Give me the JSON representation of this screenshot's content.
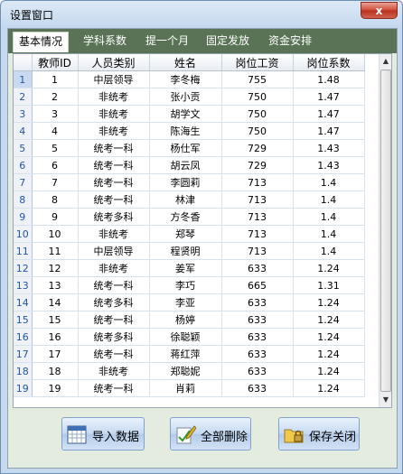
{
  "window": {
    "title": "设置窗口",
    "close_glyph": "x"
  },
  "tabs": [
    {
      "label": "基本情况",
      "active": true
    },
    {
      "label": "学科系数",
      "active": false
    },
    {
      "label": "提一个月",
      "active": false
    },
    {
      "label": "固定发放",
      "active": false
    },
    {
      "label": "资金安排",
      "active": false
    }
  ],
  "table": {
    "columns": [
      "教师ID",
      "人员类别",
      "姓名",
      "岗位工资",
      "岗位系数"
    ],
    "rows": [
      {
        "rn": "1",
        "id": "1",
        "category": "中层领导",
        "name": "李冬梅",
        "salary": "755",
        "coef": "1.48"
      },
      {
        "rn": "2",
        "id": "2",
        "category": "非统考",
        "name": "张小贡",
        "salary": "750",
        "coef": "1.47"
      },
      {
        "rn": "3",
        "id": "3",
        "category": "非统考",
        "name": "胡学文",
        "salary": "750",
        "coef": "1.47"
      },
      {
        "rn": "4",
        "id": "4",
        "category": "非统考",
        "name": "陈海生",
        "salary": "750",
        "coef": "1.47"
      },
      {
        "rn": "5",
        "id": "5",
        "category": "统考一科",
        "name": "杨仕军",
        "salary": "729",
        "coef": "1.43"
      },
      {
        "rn": "6",
        "id": "6",
        "category": "统考一科",
        "name": "胡云凤",
        "salary": "729",
        "coef": "1.43"
      },
      {
        "rn": "7",
        "id": "7",
        "category": "统考一科",
        "name": "李圆莉",
        "salary": "713",
        "coef": "1.4"
      },
      {
        "rn": "8",
        "id": "8",
        "category": "统考一科",
        "name": "林津",
        "salary": "713",
        "coef": "1.4"
      },
      {
        "rn": "9",
        "id": "9",
        "category": "统考多科",
        "name": "方冬香",
        "salary": "713",
        "coef": "1.4"
      },
      {
        "rn": "10",
        "id": "10",
        "category": "非统考",
        "name": "郑琴",
        "salary": "713",
        "coef": "1.4"
      },
      {
        "rn": "11",
        "id": "11",
        "category": "中层领导",
        "name": "程贤明",
        "salary": "713",
        "coef": "1.4"
      },
      {
        "rn": "12",
        "id": "12",
        "category": "非统考",
        "name": "姜军",
        "salary": "633",
        "coef": "1.24"
      },
      {
        "rn": "13",
        "id": "13",
        "category": "统考一科",
        "name": "李巧",
        "salary": "665",
        "coef": "1.31"
      },
      {
        "rn": "14",
        "id": "14",
        "category": "统考多科",
        "name": "李亚",
        "salary": "633",
        "coef": "1.24"
      },
      {
        "rn": "15",
        "id": "15",
        "category": "统考一科",
        "name": "杨婷",
        "salary": "633",
        "coef": "1.24"
      },
      {
        "rn": "16",
        "id": "16",
        "category": "统考多科",
        "name": "徐聪颖",
        "salary": "633",
        "coef": "1.24"
      },
      {
        "rn": "17",
        "id": "17",
        "category": "统考一科",
        "name": "蒋红萍",
        "salary": "633",
        "coef": "1.24"
      },
      {
        "rn": "18",
        "id": "18",
        "category": "非统考",
        "name": "郑聪妮",
        "salary": "633",
        "coef": "1.24"
      },
      {
        "rn": "19",
        "id": "19",
        "category": "统考一科",
        "name": "肖莉",
        "salary": "633",
        "coef": "1.24"
      }
    ]
  },
  "buttons": {
    "import_label": "导入数据",
    "delete_all_label": "全部删除",
    "save_close_label": "保存关闭"
  },
  "icons": {
    "import": "calendar-icon",
    "delete": "pencil-check-icon",
    "save": "folder-lock-icon"
  }
}
